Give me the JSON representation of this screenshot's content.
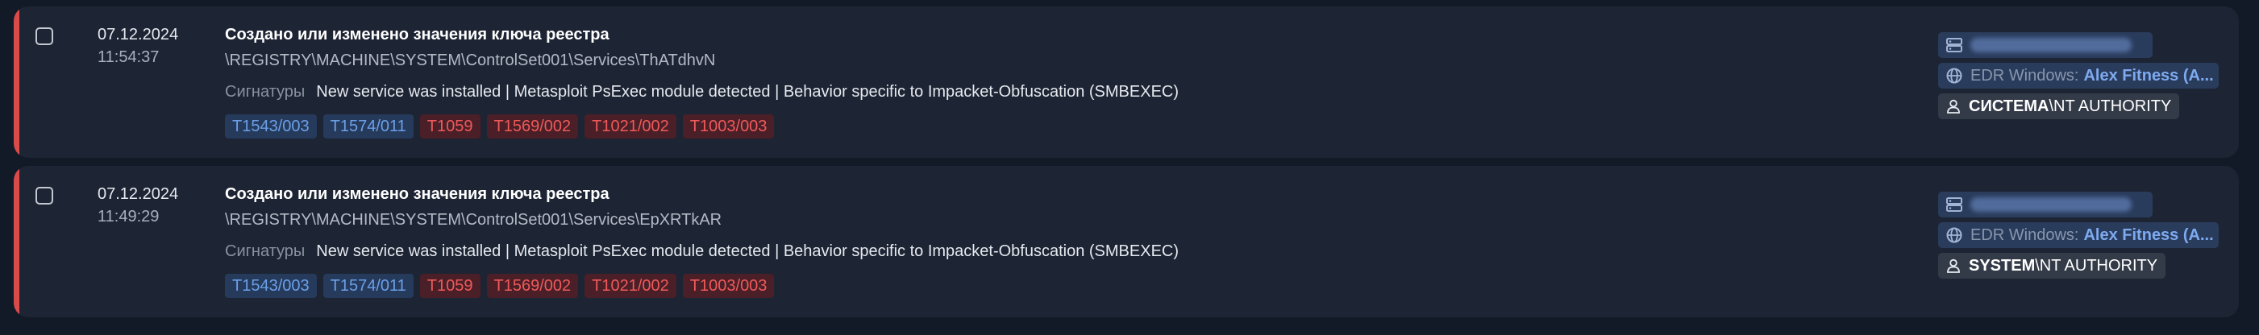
{
  "events": [
    {
      "date": "07.12.2024",
      "time": "11:54:37",
      "title": "Создано или изменено значения ключа реестра",
      "registry_path": "\\REGISTRY\\MACHINE\\SYSTEM\\ControlSet001\\Services\\ThATdhvN",
      "signatures_label": "Сигнатуры",
      "signatures": "New service was installed | Metasploit PsExec module detected | Behavior specific to Impacket-Obfuscation (SMBEXEC)",
      "techniques": [
        {
          "id": "T1543/003",
          "color": "blue"
        },
        {
          "id": "T1574/011",
          "color": "blue"
        },
        {
          "id": "T1059",
          "color": "red"
        },
        {
          "id": "T1569/002",
          "color": "red"
        },
        {
          "id": "T1021/002",
          "color": "red"
        },
        {
          "id": "T1003/003",
          "color": "red"
        }
      ],
      "edr_label": "EDR Windows:",
      "edr_name": "Alex Fitness (A...",
      "user_domain": "СИСТЕМА",
      "user_rest": "\\NT AUTHORITY",
      "severity_color": "#d94a4a"
    },
    {
      "date": "07.12.2024",
      "time": "11:49:29",
      "title": "Создано или изменено значения ключа реестра",
      "registry_path": "\\REGISTRY\\MACHINE\\SYSTEM\\ControlSet001\\Services\\EpXRTkAR",
      "signatures_label": "Сигнатуры",
      "signatures": "New service was installed | Metasploit PsExec module detected | Behavior specific to Impacket-Obfuscation (SMBEXEC)",
      "techniques": [
        {
          "id": "T1543/003",
          "color": "blue"
        },
        {
          "id": "T1574/011",
          "color": "blue"
        },
        {
          "id": "T1059",
          "color": "red"
        },
        {
          "id": "T1569/002",
          "color": "red"
        },
        {
          "id": "T1021/002",
          "color": "red"
        },
        {
          "id": "T1003/003",
          "color": "red"
        }
      ],
      "edr_label": "EDR Windows:",
      "edr_name": "Alex Fitness (A...",
      "user_domain": "SYSTEM",
      "user_rest": "\\NT AUTHORITY",
      "severity_color": "#d94a4a"
    }
  ],
  "icons": {
    "host": "server-icon",
    "edr": "globe-icon",
    "user": "user-icon"
  },
  "colors": {
    "background": "#131a27",
    "card": "#1d2433",
    "severity_high": "#d94a4a",
    "tag_blue_text": "#6aa0e8",
    "tag_red_text": "#ef5a5a"
  }
}
